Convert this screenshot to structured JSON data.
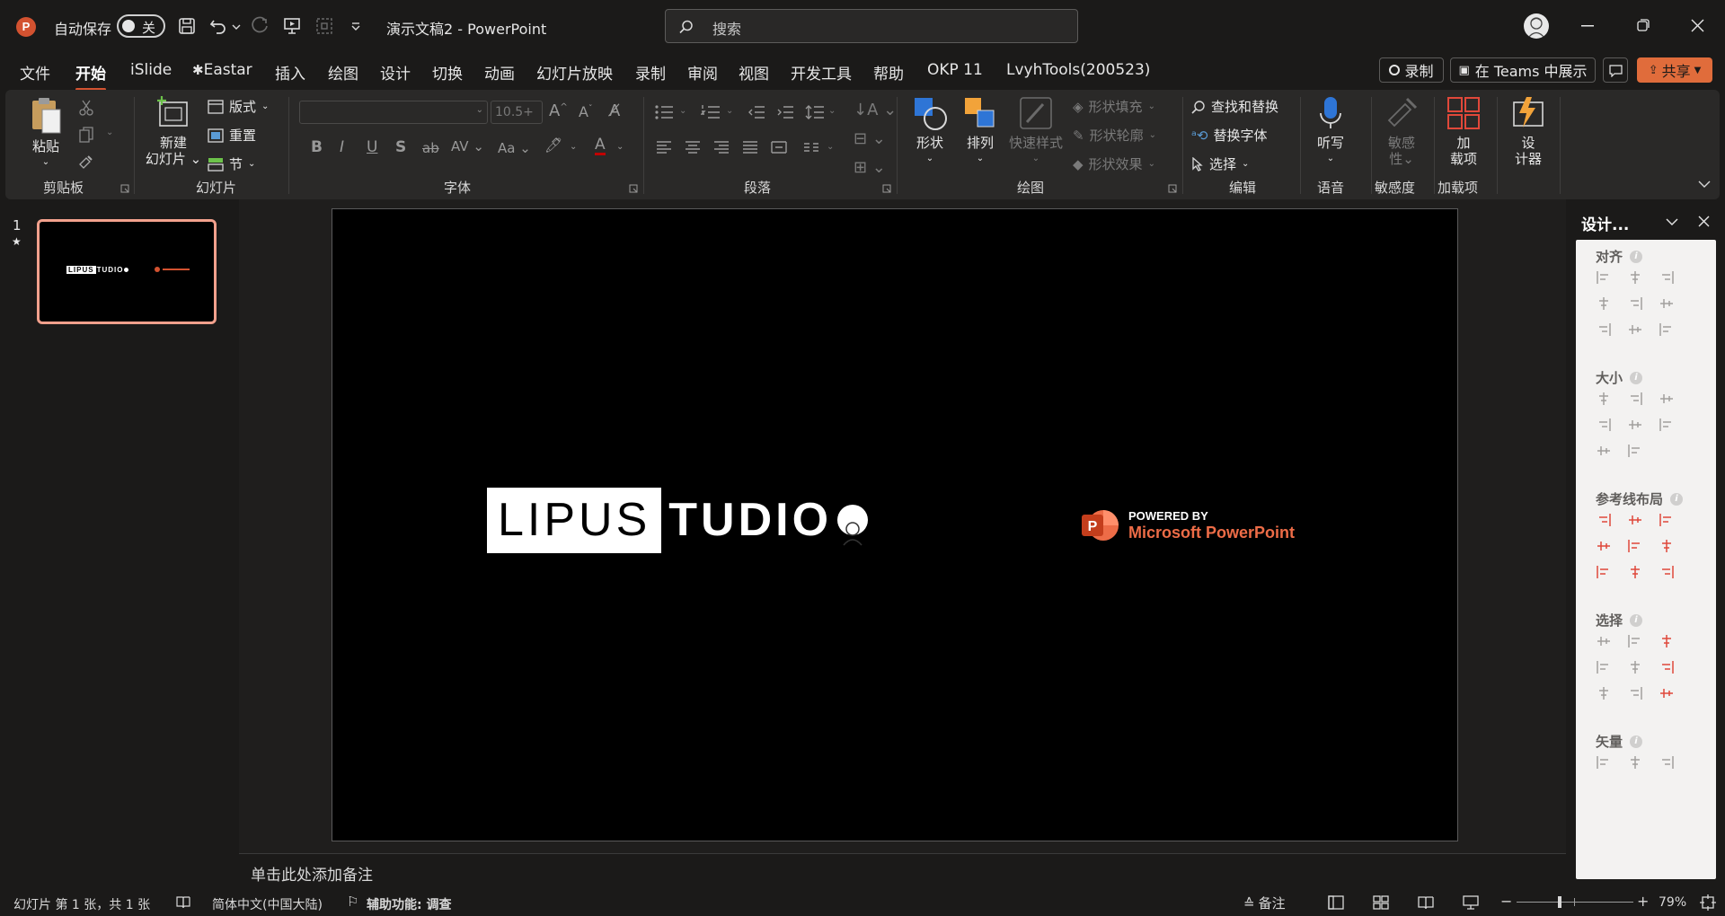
{
  "titlebar": {
    "autosave_label": "自动保存",
    "autosave_state": "关",
    "doc_title": "演示文稿2",
    "app_name": "PowerPoint",
    "title_sep": " - ",
    "search_placeholder": "搜索"
  },
  "tabs": [
    "文件",
    "开始",
    "iSlide",
    "Eastar",
    "插入",
    "绘图",
    "设计",
    "切换",
    "动画",
    "幻灯片放映",
    "录制",
    "审阅",
    "视图",
    "开发工具",
    "帮助",
    "OKP 11",
    "LvyhTools(200523)"
  ],
  "active_tab": "开始",
  "tab_right": {
    "record": "录制",
    "teams": "在 Teams 中展示",
    "share": "共享"
  },
  "ribbon": {
    "clipboard": {
      "paste": "粘贴",
      "label": "剪贴板"
    },
    "slides": {
      "new_slide_line1": "新建",
      "new_slide_line2": "幻灯片",
      "layout": "版式",
      "reset": "重置",
      "section": "节",
      "label": "幻灯片"
    },
    "font": {
      "size": "10.5+",
      "label": "字体"
    },
    "paragraph": {
      "label": "段落"
    },
    "drawing": {
      "shapes": "形状",
      "arrange": "排列",
      "quick_styles": "快速样式",
      "fill": "形状填充",
      "outline": "形状轮廓",
      "effects": "形状效果",
      "label": "绘图"
    },
    "editing": {
      "find_replace": "查找和替换",
      "replace_font": "替换字体",
      "select": "选择",
      "label": "编辑"
    },
    "voice": {
      "dictate": "听写",
      "label": "语音"
    },
    "sensitivity": {
      "btn_line1": "敏感",
      "btn_line2": "性",
      "label": "敏感度"
    },
    "addins": {
      "btn_line1": "加",
      "btn_line2": "载项",
      "label": "加载项"
    },
    "designer": {
      "btn_line1": "设",
      "btn_line2": "计器"
    }
  },
  "thumbnails": [
    {
      "number": "1",
      "star": "★"
    }
  ],
  "slide": {
    "logo_left": "LIPUS",
    "logo_right": "TUDIO",
    "powered_by": "POWERED BY",
    "ms_ppt": "Microsoft PowerPoint"
  },
  "notes_placeholder": "单击此处添加备注",
  "design_pane": {
    "title": "设计...",
    "sections": [
      "对齐",
      "大小",
      "参考线布局",
      "选择",
      "矢量"
    ]
  },
  "status": {
    "slide_info": "幻灯片 第 1 张，共 1 张",
    "language": "简体中文(中国大陆)",
    "accessibility": "辅助功能: 调查",
    "notes": "备注",
    "zoom": "79%"
  },
  "colors": {
    "accent": "#d35230",
    "share_bg": "#e06c3b"
  }
}
